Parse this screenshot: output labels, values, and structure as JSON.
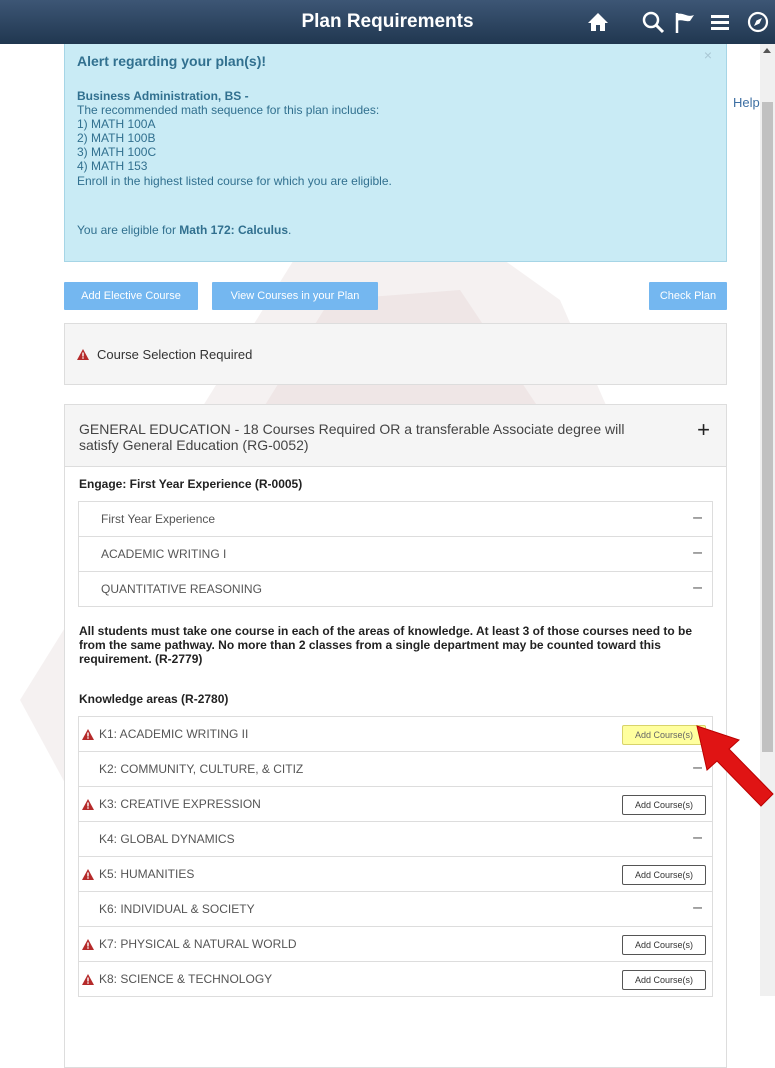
{
  "header": {
    "title": "Plan Requirements",
    "icons": [
      "home-icon",
      "search-icon",
      "flag-icon",
      "menu-icon",
      "compass-icon"
    ]
  },
  "help_link": "Help",
  "alert": {
    "close": "×",
    "heading": "Alert regarding your plan(s)!",
    "plan_name": "Business Administration, BS -",
    "lines": [
      "The recommended math sequence for this plan includes:",
      "1) MATH 100A",
      "2) MATH 100B",
      "3) MATH 100C",
      "4) MATH 153",
      "Enroll in the highest listed course for which you are eligible."
    ],
    "eligible_prefix": "You are eligible for ",
    "eligible_course": "Math 172: Calculus",
    "eligible_suffix": "."
  },
  "actions": {
    "add_elective": "Add Elective Course",
    "view_courses": "View Courses in your Plan",
    "check_plan": "Check Plan"
  },
  "course_selection": "Course Selection Required",
  "general_education": {
    "heading": "GENERAL EDUCATION - 18 Courses Required OR a transferable Associate degree will satisfy General Education (RG-0052)",
    "toggle": "+",
    "engage_title": "Engage: First Year Experience (R-0005)",
    "engage_items": [
      "First Year Experience",
      "ACADEMIC WRITING I",
      "QUANTITATIVE REASONING"
    ],
    "knowledge_note": "All students must take one course in each of the areas of knowledge. At least 3 of those courses need to be from the same pathway. No more than 2 classes from a single department may be counted toward this requirement. (R-2779)",
    "knowledge_title": "Knowledge areas (R-2780)",
    "dash": "–",
    "add_label": "Add Course(s)",
    "knowledge_items": [
      "K1: ACADEMIC WRITING II",
      "K2: COMMUNITY, CULTURE, & CITIZ",
      "K3: CREATIVE EXPRESSION",
      "K4: GLOBAL DYNAMICS",
      "K5: HUMANITIES",
      "K6: INDIVIDUAL & SOCIETY",
      "K7: PHYSICAL & NATURAL WORLD",
      "K8: SCIENCE & TECHNOLOGY"
    ]
  },
  "colors": {
    "header": "#2b4563",
    "alert_bg": "#c9ebf5",
    "button": "#74b7f0",
    "warning": "#b52a2a",
    "highlight": "#ffff9e",
    "arrow": "#e01414"
  }
}
